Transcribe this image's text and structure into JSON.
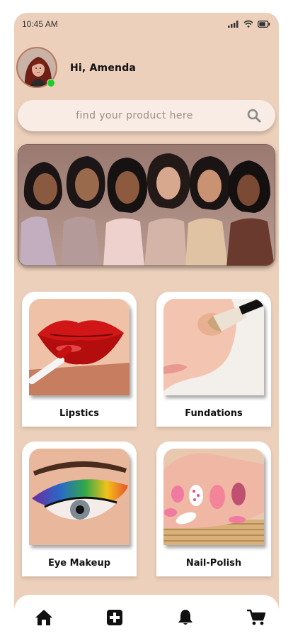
{
  "status_bar": {
    "time": "10:45 AM"
  },
  "header": {
    "greeting": "Hi, Amenda",
    "online": true
  },
  "search": {
    "placeholder": "find your product here"
  },
  "categories": [
    {
      "label": "Lipstics"
    },
    {
      "label": "Fundations"
    },
    {
      "label": "Eye Makeup"
    },
    {
      "label": "Nail-Polish"
    }
  ],
  "bottom_nav": {
    "items": [
      "home-icon",
      "add-icon",
      "bell-icon",
      "cart-icon"
    ]
  },
  "colors": {
    "background": "#ecd0bb",
    "online": "#1fcd2a",
    "card": "#ffffff"
  }
}
